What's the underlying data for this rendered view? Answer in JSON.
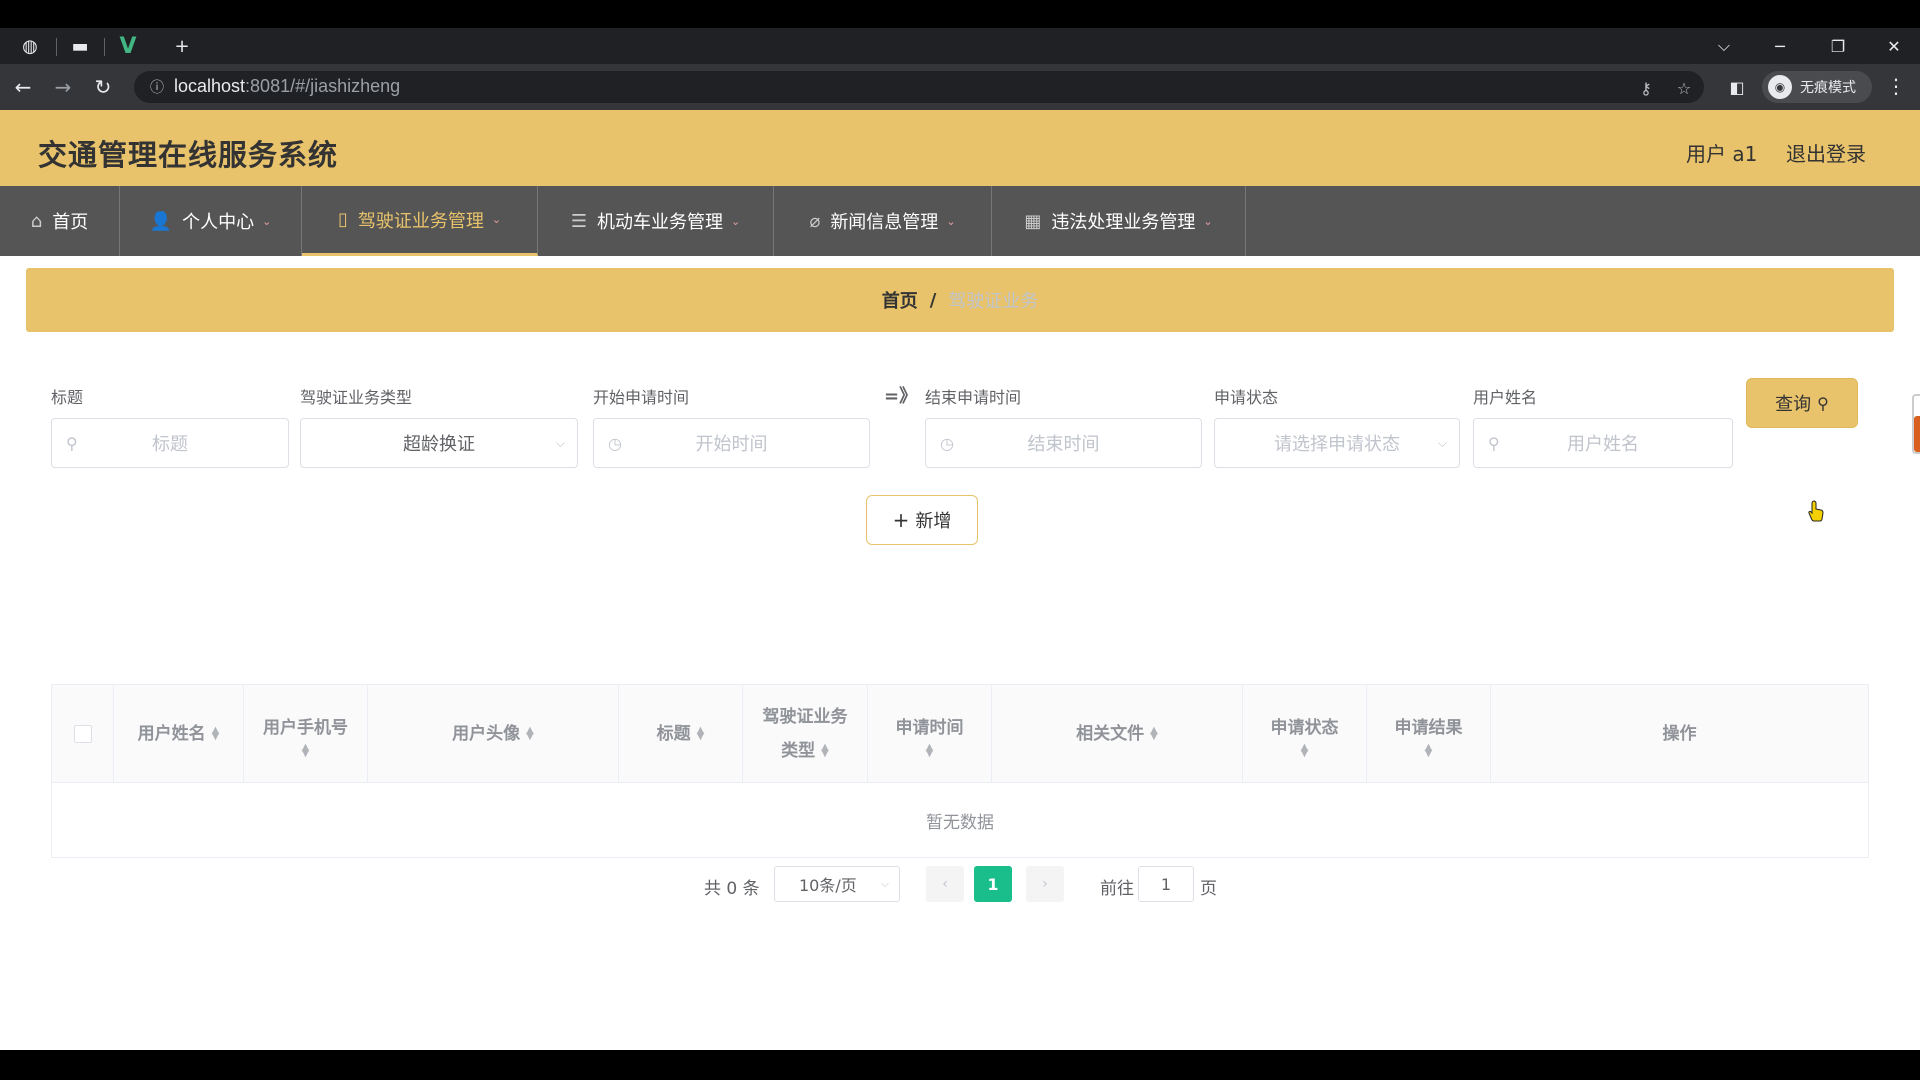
{
  "browser": {
    "url_host": "localhost",
    "url_rest": ":8081/#/jiashizheng",
    "incognito_label": "无痕模式"
  },
  "header": {
    "app_title": "交通管理在线服务系统",
    "user_label": "用户 a1",
    "logout_label": "退出登录"
  },
  "nav": {
    "items": [
      {
        "label": "首页",
        "icon": "home-icon"
      },
      {
        "label": "个人中心",
        "icon": "user-icon"
      },
      {
        "label": "驾驶证业务管理",
        "icon": "license-icon"
      },
      {
        "label": "机动车业务管理",
        "icon": "list-icon"
      },
      {
        "label": "新闻信息管理",
        "icon": "news-icon"
      },
      {
        "label": "违法处理业务管理",
        "icon": "grid-icon"
      }
    ],
    "active_index": 2
  },
  "breadcrumb": {
    "home": "首页",
    "separator": "/",
    "current": "驾驶证业务"
  },
  "filters": {
    "title": {
      "label": "标题",
      "placeholder": "标题"
    },
    "type": {
      "label": "驾驶证业务类型",
      "value": "超龄换证"
    },
    "start": {
      "label": "开始申请时间",
      "placeholder": "开始时间"
    },
    "range_symbol": "=》",
    "end": {
      "label": "结束申请时间",
      "placeholder": "结束时间"
    },
    "status": {
      "label": "申请状态",
      "placeholder": "请选择申请状态"
    },
    "username": {
      "label": "用户姓名",
      "placeholder": "用户姓名"
    },
    "search_button": "查询",
    "add_button": "新增"
  },
  "table": {
    "headers": {
      "username": "用户姓名",
      "phone": "用户手机号",
      "avatar": "用户头像",
      "title": "标题",
      "type_line1": "驾驶证业务",
      "type_line2": "类型",
      "time": "申请时间",
      "files": "相关文件",
      "status": "申请状态",
      "result": "申请结果",
      "actions": "操作"
    },
    "empty_text": "暂无数据"
  },
  "pagination": {
    "total_text": "共 0 条",
    "page_size": "10条/页",
    "current_page": "1",
    "goto_label": "前往",
    "goto_value": "1",
    "page_suffix": "页"
  },
  "colors": {
    "brand": "#e8c36b",
    "nav_bg": "#555555",
    "page_active": "#19be8b"
  }
}
